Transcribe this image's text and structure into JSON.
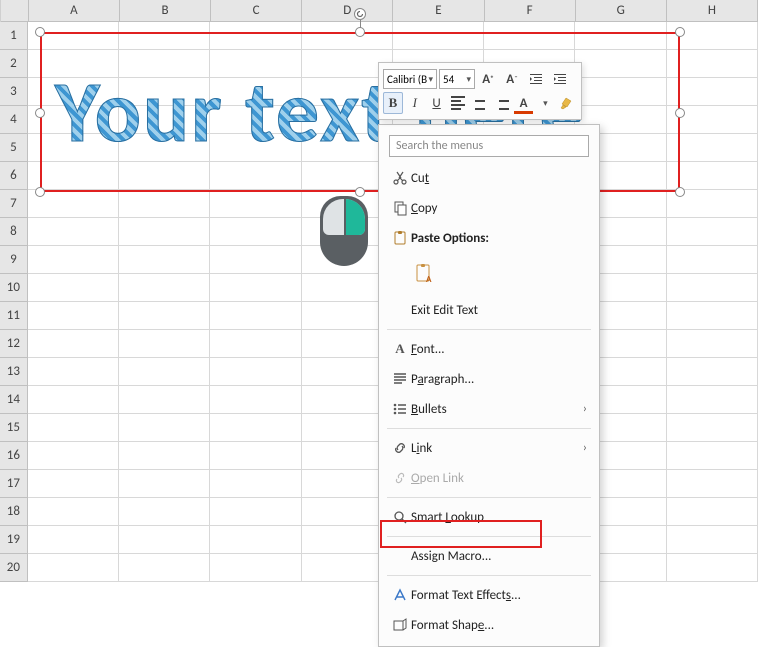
{
  "columns": [
    "A",
    "B",
    "C",
    "D",
    "E",
    "F",
    "G",
    "H"
  ],
  "rows": [
    "1",
    "2",
    "3",
    "4",
    "5",
    "6",
    "7",
    "8",
    "9",
    "10",
    "11",
    "12",
    "13",
    "14",
    "15",
    "16",
    "17",
    "18",
    "19",
    "20"
  ],
  "wordart_text": "Your text here",
  "mini_toolbar": {
    "font_name": "Calibri (B",
    "font_size": "54",
    "grow": "A",
    "shrink": "A",
    "bold": "B",
    "italic": "I",
    "underline": "U",
    "colorA": "A"
  },
  "ctx": {
    "search_placeholder": "Search the menus",
    "cut_icon": "cut",
    "cut_label_pre": "Cu",
    "cut_mnm": "t",
    "copy_label_mnm": "C",
    "copy_label_post": "opy",
    "paste_header": "Paste Options:",
    "exit_edit": "Exit Edit Text",
    "font_pre": "",
    "font_mnm": "F",
    "font_post": "ont...",
    "para_pre": "P",
    "para_mnm": "a",
    "para_post": "ragraph...",
    "bullets_mnm": "B",
    "bullets_post": "ullets",
    "link_pre": "L",
    "link_mnm": "i",
    "link_post": "nk",
    "openlink_pre": "",
    "openlink_mnm": "O",
    "openlink_post": "pen Link",
    "smart_pre": "Smart ",
    "smart_mnm": "L",
    "smart_post": "ookup",
    "assign_pre": "Assi",
    "assign_mnm": "g",
    "assign_post": "n Macro...",
    "fte_pre": "Format Text Effect",
    "fte_mnm": "s",
    "fte_post": "...",
    "fshape_pre": "Format Shap",
    "fshape_mnm": "e",
    "fshape_post": "..."
  },
  "highlight_target": "format-text-effects"
}
